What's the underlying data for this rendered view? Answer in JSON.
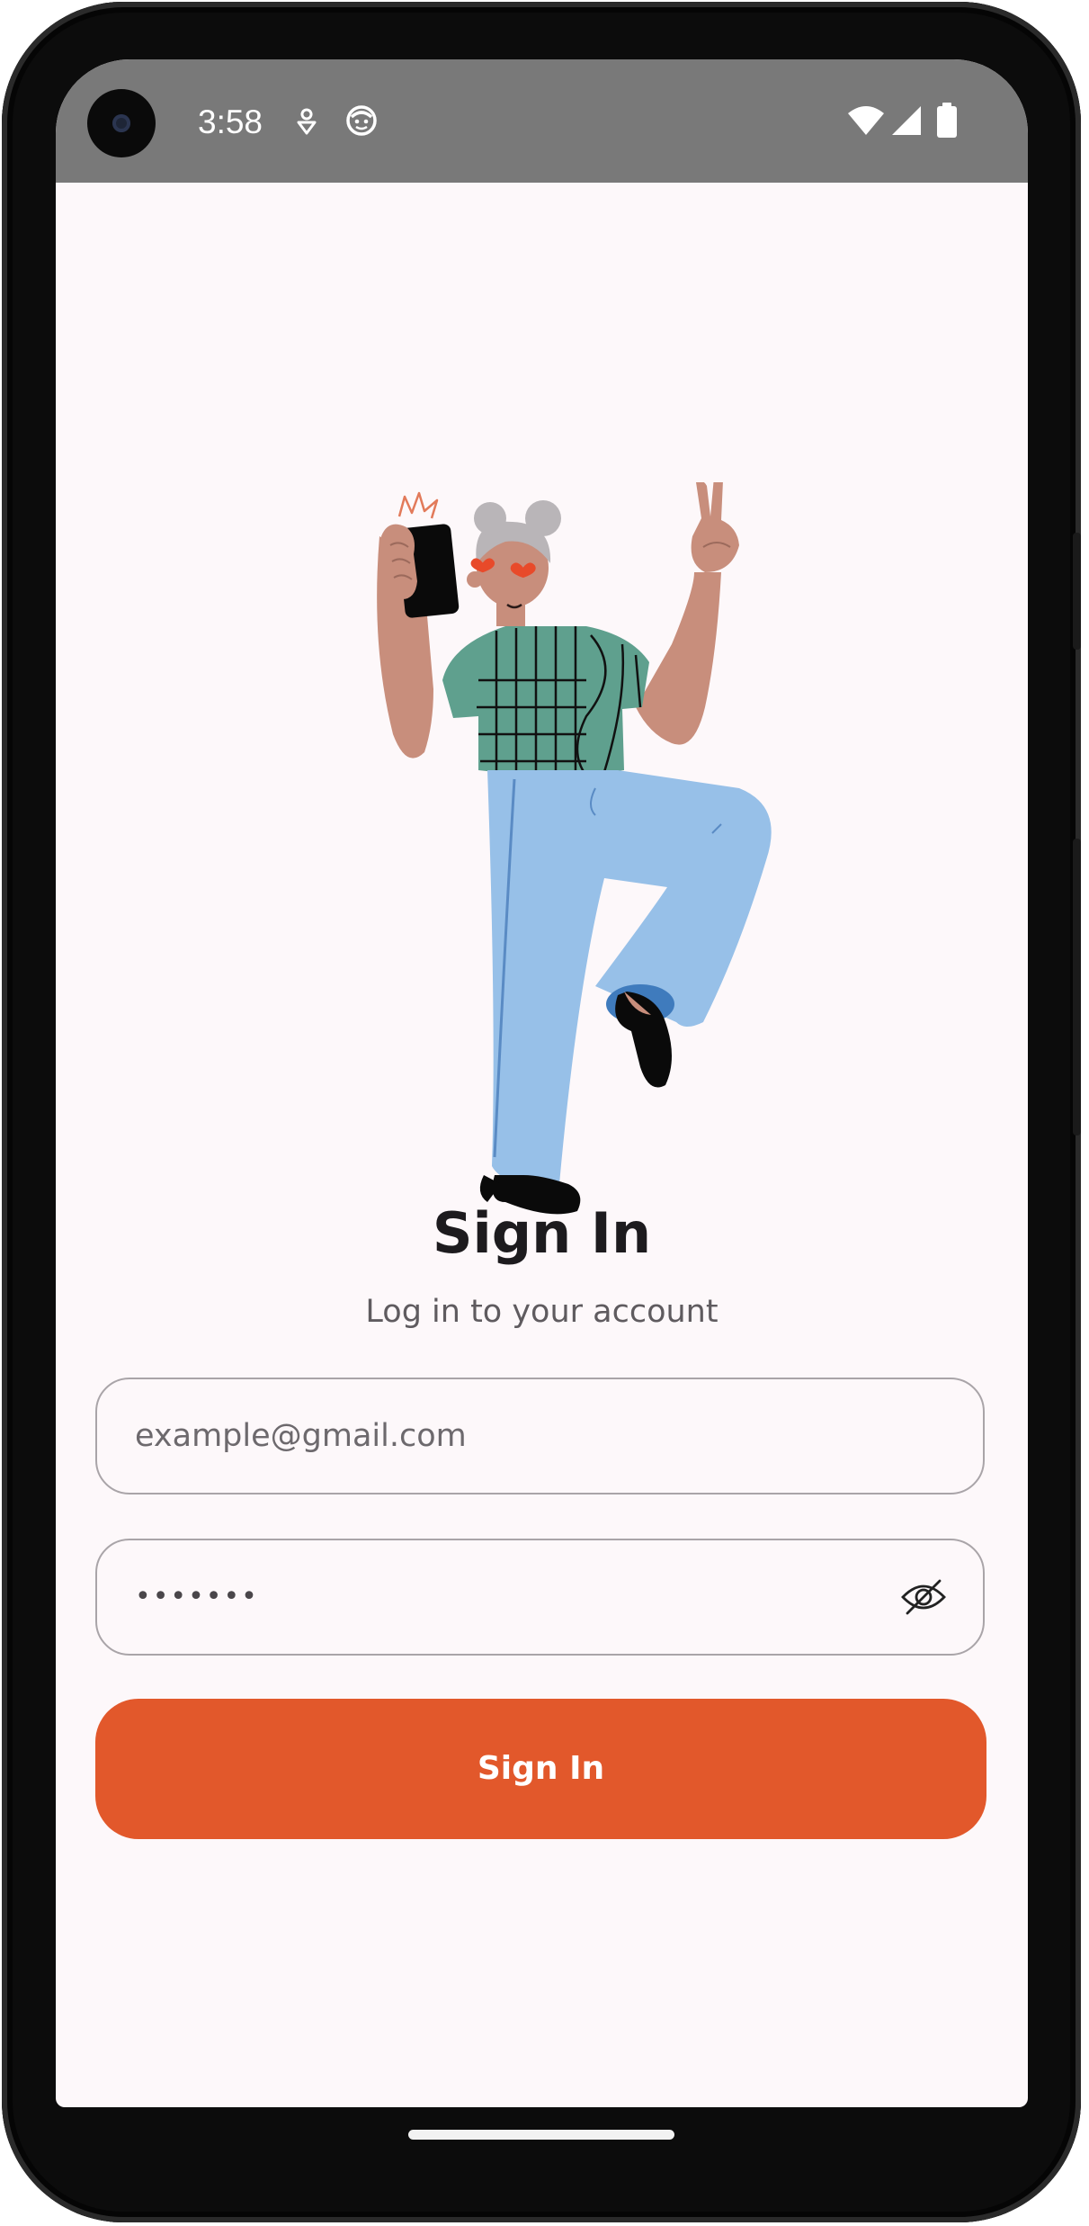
{
  "status_bar": {
    "time": "3:58",
    "icons": [
      "notification-icon",
      "face-icon",
      "wifi-icon",
      "signal-icon",
      "battery-icon"
    ],
    "background": "#797979"
  },
  "illustration": {
    "name": "woman-peace-sign-illustration"
  },
  "header": {
    "title": "Sign In",
    "subtitle": "Log in to your account"
  },
  "form": {
    "email_placeholder": "example@gmail.com",
    "password_value": "•••••••",
    "visibility_icon": "eye-off-icon",
    "submit_label": "Sign In"
  },
  "colors": {
    "accent": "#e2582b",
    "background": "#fdf8fa",
    "title": "#1d1b1e",
    "subtitle": "#5f5b5f",
    "field_border": "#a9a4a8"
  }
}
